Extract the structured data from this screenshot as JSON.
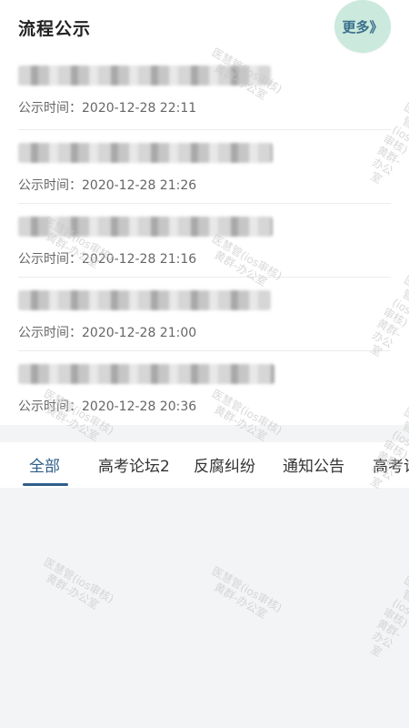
{
  "section": {
    "title": "流程公示",
    "more_label": "更多》"
  },
  "items": [
    {
      "time": "公示时间：2020-12-28 22:11"
    },
    {
      "time": "公示时间：2020-12-28 21:26"
    },
    {
      "time": "公示时间：2020-12-28 21:16"
    },
    {
      "time": "公示时间：2020-12-28 21:00"
    },
    {
      "time": "公示时间：2020-12-28 20:36"
    }
  ],
  "tabs": [
    {
      "label": "全部",
      "active": true
    },
    {
      "label": "高考论坛2",
      "active": false
    },
    {
      "label": "反腐纠纷",
      "active": false
    },
    {
      "label": "通知公告",
      "active": false
    },
    {
      "label": "高考论",
      "active": false
    }
  ],
  "watermark": {
    "line1": "医慧管(ios审核)",
    "line2": "黄群-办公室"
  },
  "colors": {
    "accent": "#2f5d8a",
    "more_bg": "#cbe9dc",
    "page_bg": "#f3f4f6"
  }
}
